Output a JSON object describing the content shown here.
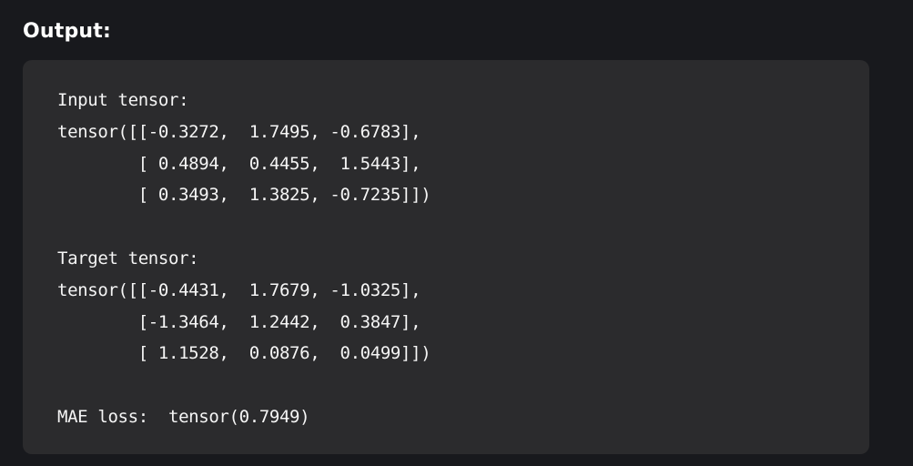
{
  "heading": "Output:",
  "code_lines": [
    "Input tensor:",
    "tensor([[-0.3272,  1.7495, -0.6783],",
    "        [ 0.4894,  0.4455,  1.5443],",
    "        [ 0.3493,  1.3825, -0.7235]])",
    "",
    "Target tensor:",
    "tensor([[-0.4431,  1.7679, -1.0325],",
    "        [-1.3464,  1.2442,  0.3847],",
    "        [ 1.1528,  0.0876,  0.0499]])",
    "",
    "MAE loss:  tensor(0.7949)"
  ]
}
